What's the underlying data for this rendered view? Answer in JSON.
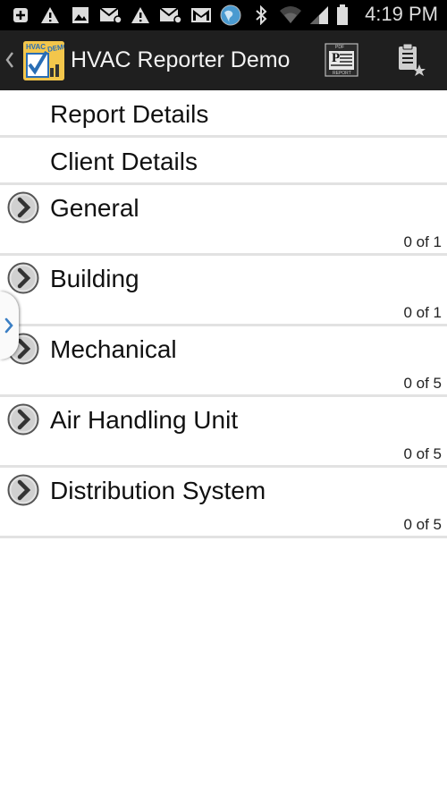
{
  "status_bar": {
    "time": "4:19 PM",
    "icons": [
      "add-box-icon",
      "warning-icon",
      "image-icon",
      "email-icon",
      "warning-icon",
      "email-icon",
      "gmail-icon",
      "globe-icon",
      "bluetooth-icon",
      "wifi-icon",
      "signal-icon",
      "battery-icon"
    ]
  },
  "action_bar": {
    "title": "HVAC Reporter Demo",
    "logo_text_top": "HVAC",
    "logo_text_side": "DEMO",
    "pdf_label_top": "PDF",
    "pdf_label_bottom": "REPORT",
    "pdf_letter": "P"
  },
  "list": {
    "simple_items": [
      {
        "label": "Report Details"
      },
      {
        "label": "Client Details"
      }
    ],
    "sections": [
      {
        "label": "General",
        "count": "0 of 1"
      },
      {
        "label": "Building",
        "count": "0 of 1"
      },
      {
        "label": "Mechanical",
        "count": "0 of 5"
      },
      {
        "label": "Air Handling Unit",
        "count": "0 of 5"
      },
      {
        "label": "Distribution System",
        "count": "0 of 5"
      }
    ]
  },
  "colors": {
    "status_bar_bg": "#000000",
    "action_bar_bg": "#1f1f1f",
    "logo_bg": "#f3c64b",
    "divider": "#e2e2e2",
    "drawer_arrow": "#3b7fc4"
  }
}
